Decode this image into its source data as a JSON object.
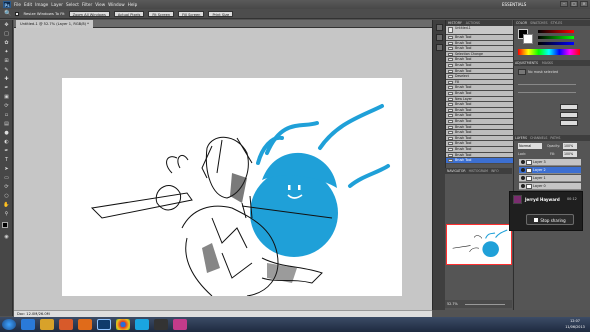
{
  "app": {
    "logo": "Ps",
    "workspace": "ESSENTIALS"
  },
  "menu": [
    "File",
    "Edit",
    "Image",
    "Layer",
    "Select",
    "Filter",
    "View",
    "Window",
    "Help"
  ],
  "window_controls": [
    "–",
    "□",
    "×"
  ],
  "options_bar": {
    "checkbox_label": "Resize Windows To Fit",
    "buttons": [
      "Zoom All Windows",
      "Actual Pixels",
      "Fit Screen",
      "Fill Screen",
      "Print Size"
    ]
  },
  "document": {
    "tab_title": "Untitled-1 @ 52.7% (Layer 1, RGB/8) *",
    "status": "Doc: 12.0M/26.0M"
  },
  "history": {
    "tabs": [
      "HISTORY",
      "ACTIONS"
    ],
    "doc_name": "Untitled-1",
    "items": [
      "Brush Tool",
      "Brush Tool",
      "Brush Tool",
      "Selection Change",
      "Brush Tool",
      "Brush Tool",
      "Brush Tool",
      "Deselect",
      "Fill",
      "Brush Tool",
      "Brush Tool",
      "New Layer",
      "Brush Tool",
      "Brush Tool",
      "Brush Tool",
      "Brush Tool",
      "Brush Tool",
      "Brush Tool",
      "Brush Tool",
      "Brush Tool",
      "Brush Tool",
      "Brush Tool",
      "Brush Tool"
    ]
  },
  "navigator": {
    "tabs": [
      "NAVIGATOR",
      "HISTOGRAM",
      "INFO"
    ],
    "zoom": "52.7%"
  },
  "color_panel": {
    "tabs": [
      "COLOR",
      "SWATCHES",
      "STYLES"
    ],
    "fg": "#000000",
    "bg": "#ffffff"
  },
  "adjustments": {
    "tabs": [
      "ADJUSTMENTS",
      "MASKS"
    ],
    "mask_status": "No mask selected"
  },
  "layers": {
    "tabs": [
      "LAYERS",
      "CHANNELS",
      "PATHS"
    ],
    "blend": "Normal",
    "opacity_label": "Opacity:",
    "opacity": "100%",
    "lock_label": "Lock:",
    "fill_label": "Fill:",
    "fill": "100%",
    "items": [
      {
        "name": "Layer 3",
        "selected": false
      },
      {
        "name": "Layer 2",
        "selected": true
      },
      {
        "name": "Layer 1",
        "selected": false
      },
      {
        "name": "Layer 0",
        "selected": false
      }
    ]
  },
  "share": {
    "user": "Jerryd Hayward",
    "time": "00:12",
    "button": "Stop sharing"
  },
  "taskbar": {
    "apps": [
      "start",
      "ie",
      "explorer",
      "media",
      "firefox",
      "ps",
      "chrome",
      "skype",
      "steam",
      "misc"
    ]
  },
  "clock": {
    "time": "12:07",
    "date": "11/06/2013"
  },
  "colors": {
    "accent_blue": "#1fa0d8",
    "selection_blue": "#3c6fd1",
    "nav_frame": "#ff3030"
  }
}
